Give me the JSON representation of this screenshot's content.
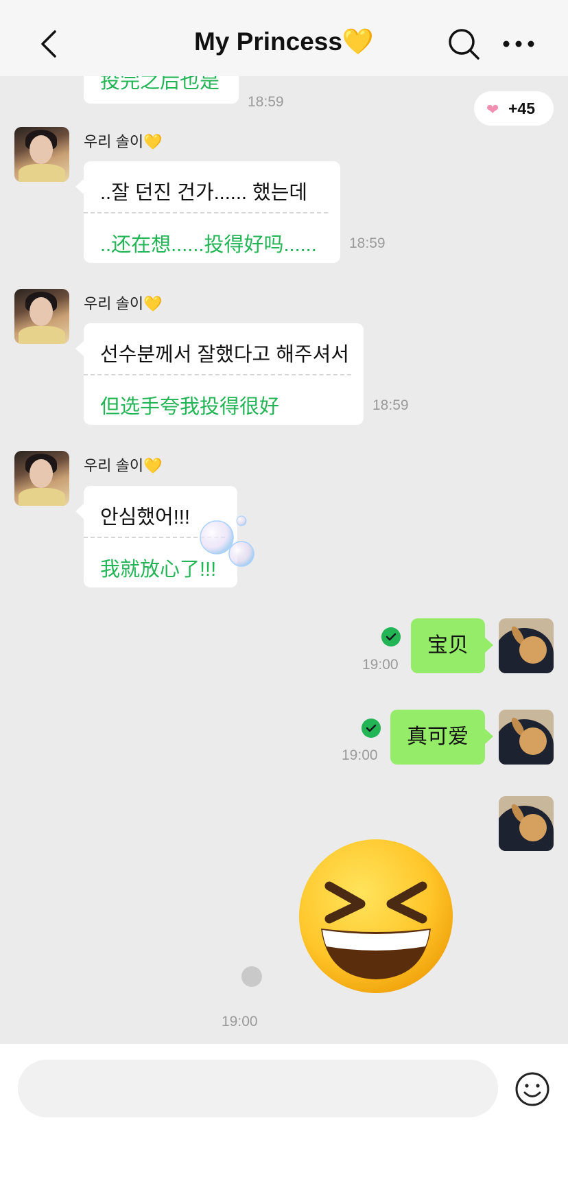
{
  "header": {
    "title": "My Princess💛"
  },
  "reaction": {
    "icon": "heart-icon",
    "count": "+45"
  },
  "messages": [
    {
      "cn": "投完之后也是",
      "time": "18:59"
    },
    {
      "sender": "우리 솔이💛",
      "ko": "..잘 던진 건가...... 했는데",
      "cn": "..还在想......投得好吗......",
      "time": "18:59"
    },
    {
      "sender": "우리 솔이💛",
      "ko": "선수분께서 잘했다고 해주셔서",
      "cn": "但选手夸我投得很好",
      "time": "18:59"
    },
    {
      "sender": "우리 솔이💛",
      "ko": "안심했어!!!",
      "cn": "我就放心了!!!"
    }
  ],
  "my_messages": [
    {
      "text": "宝贝",
      "time": "19:00"
    },
    {
      "text": "真可爱",
      "time": "19:00"
    },
    {
      "sticker": "😆",
      "time": "19:00"
    }
  ],
  "input": {
    "placeholder": ""
  },
  "colors": {
    "accent_green": "#22b455",
    "my_bubble": "#95ec69",
    "background": "#ebebeb"
  }
}
